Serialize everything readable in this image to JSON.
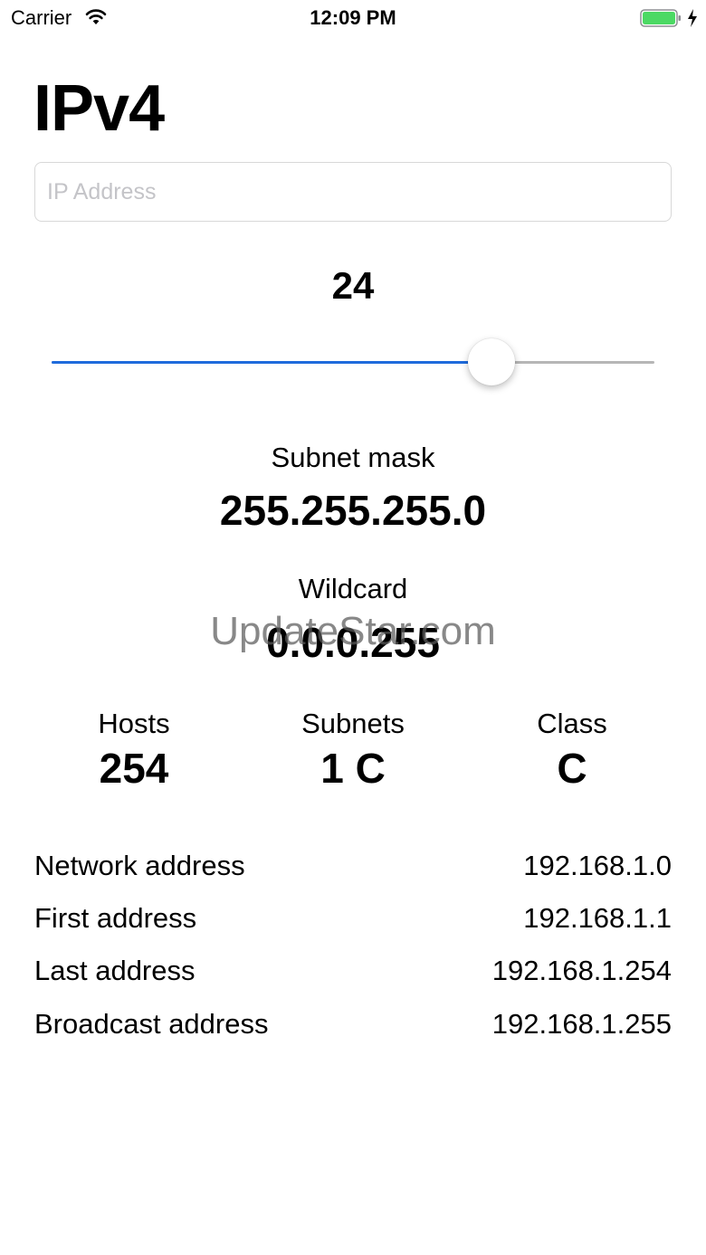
{
  "status_bar": {
    "carrier": "Carrier",
    "time": "12:09 PM",
    "icons": [
      "wifi-icon",
      "battery-icon",
      "charging-icon"
    ],
    "battery_color": "#4cd964"
  },
  "title": "IPv4",
  "ip_input": {
    "placeholder": "IP Address",
    "value": ""
  },
  "prefix": {
    "value": "24",
    "slider_level": 0.73,
    "accent_color": "#1f6bdc"
  },
  "subnet_mask": {
    "label": "Subnet mask",
    "value": "255.255.255.0"
  },
  "wildcard": {
    "label": "Wildcard",
    "value": "0.0.0.255"
  },
  "watermark": "UpdateStar.com",
  "stats": [
    {
      "label": "Hosts",
      "value": "254"
    },
    {
      "label": "Subnets",
      "value": "1 C"
    },
    {
      "label": "Class",
      "value": "C"
    }
  ],
  "addresses": [
    {
      "label": "Network address",
      "value": "192.168.1.0"
    },
    {
      "label": "First address",
      "value": "192.168.1.1"
    },
    {
      "label": "Last address",
      "value": "192.168.1.254"
    },
    {
      "label": "Broadcast address",
      "value": "192.168.1.255"
    }
  ]
}
